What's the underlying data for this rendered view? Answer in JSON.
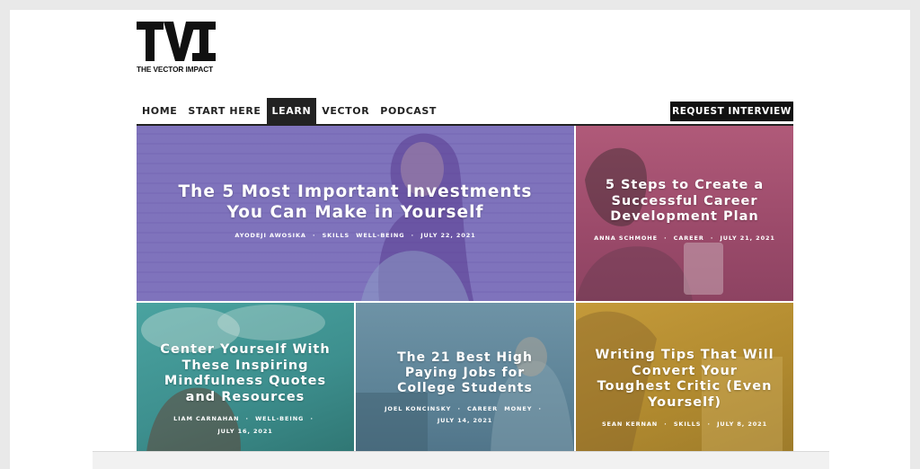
{
  "logo": {
    "mark": "TVI",
    "name": "THE VECTOR IMPACT"
  },
  "nav": {
    "items": [
      {
        "label": "HOME"
      },
      {
        "label": "START HERE"
      },
      {
        "label": "LEARN",
        "active": true
      },
      {
        "label": "VECTOR"
      },
      {
        "label": "PODCAST"
      }
    ],
    "cta_label": "REQUEST INTERVIEW"
  },
  "articles": [
    {
      "title_lines": [
        "The 5 Most Important Investments",
        "You Can Make in Yourself"
      ],
      "author": "AYODEJI AWOSIKA",
      "categories": [
        "SKILLS",
        "WELL-BEING"
      ],
      "date": "JULY 22, 2021",
      "tint": "#7d6fc0"
    },
    {
      "title_lines": [
        "5 Steps to Create a",
        "Successful Career",
        "Development Plan"
      ],
      "author": "ANNA SCHMOHE",
      "categories": [
        "CAREER"
      ],
      "date": "JULY 21, 2021",
      "tint": "#a4516f"
    },
    {
      "title_lines": [
        "Center Yourself With",
        "These Inspiring",
        "Mindfulness Quotes",
        "and Resources"
      ],
      "author": "LIAM CARNAHAN",
      "categories": [
        "WELL-BEING"
      ],
      "date": "JULY 16, 2021",
      "tint": "#3e9290"
    },
    {
      "title_lines": [
        "The 21 Best High",
        "Paying Jobs for",
        "College Students"
      ],
      "author": "JOEL KONCINSKY",
      "categories": [
        "CAREER",
        "MONEY"
      ],
      "date": "JULY 14, 2021",
      "tint": "#5f8699"
    },
    {
      "title_lines": [
        "Writing Tips That Will",
        "Convert Your",
        "Toughest Critic (Even",
        "Yourself)"
      ],
      "author": "SEAN KERNAN",
      "categories": [
        "SKILLS"
      ],
      "date": "JULY 8, 2021",
      "tint": "#b58d31"
    }
  ]
}
